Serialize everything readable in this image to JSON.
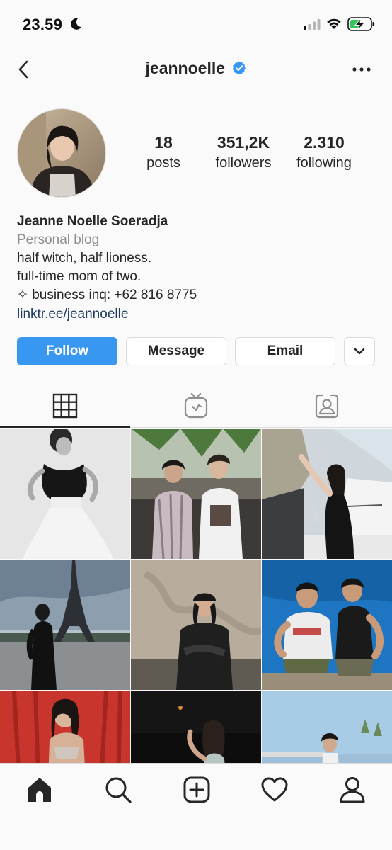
{
  "status_bar": {
    "time": "23.59",
    "icons": [
      "moon-icon",
      "cellular-signal-icon",
      "wifi-icon",
      "battery-charging-icon"
    ]
  },
  "header": {
    "username": "jeannoelle",
    "verified": true,
    "back_icon": "chevron-left-icon",
    "more_icon": "more-horizontal-icon"
  },
  "profile": {
    "stats": [
      {
        "value": "18",
        "label": "posts"
      },
      {
        "value": "351,2K",
        "label": "followers"
      },
      {
        "value": "2.310",
        "label": "following"
      }
    ],
    "full_name": "Jeanne Noelle Soeradja",
    "category": "Personal blog",
    "bio_lines": [
      "half witch, half lioness.",
      "full-time mom of two.",
      "✧ business inq: +62 816 8775"
    ],
    "link": "linktr.ee/jeannoelle"
  },
  "actions": {
    "follow": "Follow",
    "message": "Message",
    "email": "Email",
    "more_icon": "chevron-down-icon"
  },
  "tabs": [
    {
      "icon": "grid-icon",
      "active": true
    },
    {
      "icon": "igtv-icon",
      "active": false
    },
    {
      "icon": "tagged-icon",
      "active": false
    }
  ],
  "bottom_nav": [
    {
      "icon": "home-icon",
      "active": true
    },
    {
      "icon": "search-icon",
      "active": false
    },
    {
      "icon": "add-post-icon",
      "active": false
    },
    {
      "icon": "heart-icon",
      "active": false
    },
    {
      "icon": "profile-icon",
      "active": false
    }
  ],
  "colors": {
    "follow_button": "#3897f0",
    "verified_badge": "#3897f0",
    "link_text": "#1e3a62",
    "secondary_text": "#8e8e8e",
    "text": "#262626",
    "background": "#fafafa"
  }
}
